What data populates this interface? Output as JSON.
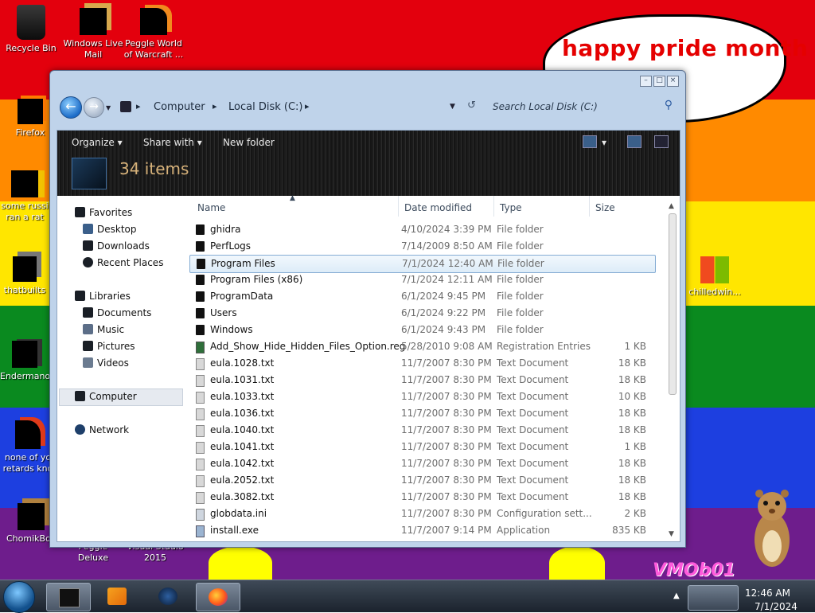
{
  "desktop": {
    "bubble_text": "happy pride month",
    "watermark": "VMOb01",
    "icons": [
      {
        "label": "Recycle Bin",
        "icon": "recycle-bin-icon"
      },
      {
        "label": "Windows Live Mail",
        "icon": "windows-live-mail-icon"
      },
      {
        "label": "Peggle World of Warcraft ...",
        "icon": "peggle-wow-icon"
      },
      {
        "label": "Firefox",
        "icon": "firefox-icon"
      },
      {
        "label": "some russi ran a rat",
        "icon": "shortcut-icon"
      },
      {
        "label": "thatbuilts",
        "icon": "shortcut-icon"
      },
      {
        "label": "Endermano",
        "icon": "shortcut-icon"
      },
      {
        "label": "none of yo retards kno",
        "icon": "shortcut-icon"
      },
      {
        "label": "ChomikBox",
        "icon": "chomikbox-icon"
      },
      {
        "label": "Peggle Deluxe",
        "icon": "peggle-deluxe-icon"
      },
      {
        "label": "Visual Studio 2015",
        "icon": "visual-studio-icon"
      },
      {
        "label": "chilledwin...",
        "icon": "windows-flag-icon"
      }
    ]
  },
  "window": {
    "breadcrumb": [
      "Computer",
      "Local Disk (C:)"
    ],
    "search_placeholder": "Search Local Disk (C:)",
    "toolbar": {
      "organize": "Organize",
      "share_with": "Share with",
      "new_folder": "New folder"
    },
    "item_count": "34 items",
    "nav": {
      "favorites": "Favorites",
      "desktop": "Desktop",
      "downloads": "Downloads",
      "recent_places": "Recent Places",
      "libraries": "Libraries",
      "documents": "Documents",
      "music": "Music",
      "pictures": "Pictures",
      "videos": "Videos",
      "computer": "Computer",
      "network": "Network"
    },
    "columns": {
      "name": "Name",
      "date": "Date modified",
      "type": "Type",
      "size": "Size"
    },
    "files": [
      {
        "name": "ghidra",
        "date": "4/10/2024 3:39 PM",
        "type": "File folder",
        "size": "",
        "kind": "folder"
      },
      {
        "name": "PerfLogs",
        "date": "7/14/2009 8:50 AM",
        "type": "File folder",
        "size": "",
        "kind": "folder"
      },
      {
        "name": "Program Files",
        "date": "7/1/2024 12:40 AM",
        "type": "File folder",
        "size": "",
        "kind": "folder"
      },
      {
        "name": "Program Files (x86)",
        "date": "7/1/2024 12:11 AM",
        "type": "File folder",
        "size": "",
        "kind": "folder"
      },
      {
        "name": "ProgramData",
        "date": "6/1/2024 9:45 PM",
        "type": "File folder",
        "size": "",
        "kind": "folder"
      },
      {
        "name": "Users",
        "date": "6/1/2024 9:22 PM",
        "type": "File folder",
        "size": "",
        "kind": "folder"
      },
      {
        "name": "Windows",
        "date": "6/1/2024 9:43 PM",
        "type": "File folder",
        "size": "",
        "kind": "folder"
      },
      {
        "name": "Add_Show_Hide_Hidden_Files_Option.reg",
        "date": "5/28/2010 9:08 AM",
        "type": "Registration Entries",
        "size": "1 KB",
        "kind": "reg"
      },
      {
        "name": "eula.1028.txt",
        "date": "11/7/2007 8:30 PM",
        "type": "Text Document",
        "size": "18 KB",
        "kind": "txt"
      },
      {
        "name": "eula.1031.txt",
        "date": "11/7/2007 8:30 PM",
        "type": "Text Document",
        "size": "18 KB",
        "kind": "txt"
      },
      {
        "name": "eula.1033.txt",
        "date": "11/7/2007 8:30 PM",
        "type": "Text Document",
        "size": "10 KB",
        "kind": "txt"
      },
      {
        "name": "eula.1036.txt",
        "date": "11/7/2007 8:30 PM",
        "type": "Text Document",
        "size": "18 KB",
        "kind": "txt"
      },
      {
        "name": "eula.1040.txt",
        "date": "11/7/2007 8:30 PM",
        "type": "Text Document",
        "size": "18 KB",
        "kind": "txt"
      },
      {
        "name": "eula.1041.txt",
        "date": "11/7/2007 8:30 PM",
        "type": "Text Document",
        "size": "1 KB",
        "kind": "txt"
      },
      {
        "name": "eula.1042.txt",
        "date": "11/7/2007 8:30 PM",
        "type": "Text Document",
        "size": "18 KB",
        "kind": "txt"
      },
      {
        "name": "eula.2052.txt",
        "date": "11/7/2007 8:30 PM",
        "type": "Text Document",
        "size": "18 KB",
        "kind": "txt"
      },
      {
        "name": "eula.3082.txt",
        "date": "11/7/2007 8:30 PM",
        "type": "Text Document",
        "size": "18 KB",
        "kind": "txt"
      },
      {
        "name": "globdata.ini",
        "date": "11/7/2007 8:30 PM",
        "type": "Configuration sett...",
        "size": "2 KB",
        "kind": "ini"
      },
      {
        "name": "install.exe",
        "date": "11/7/2007 9:14 PM",
        "type": "Application",
        "size": "835 KB",
        "kind": "exe"
      }
    ],
    "selected_index": 2
  },
  "taskbar": {
    "time": "12:46 AM",
    "date": "7/1/2024",
    "apps": [
      "explorer-icon",
      "media-player-icon",
      "globe-icon",
      "firefox-icon"
    ]
  },
  "colors": {
    "bubble_text": "#e50000",
    "accent": "#1c6cc8"
  }
}
